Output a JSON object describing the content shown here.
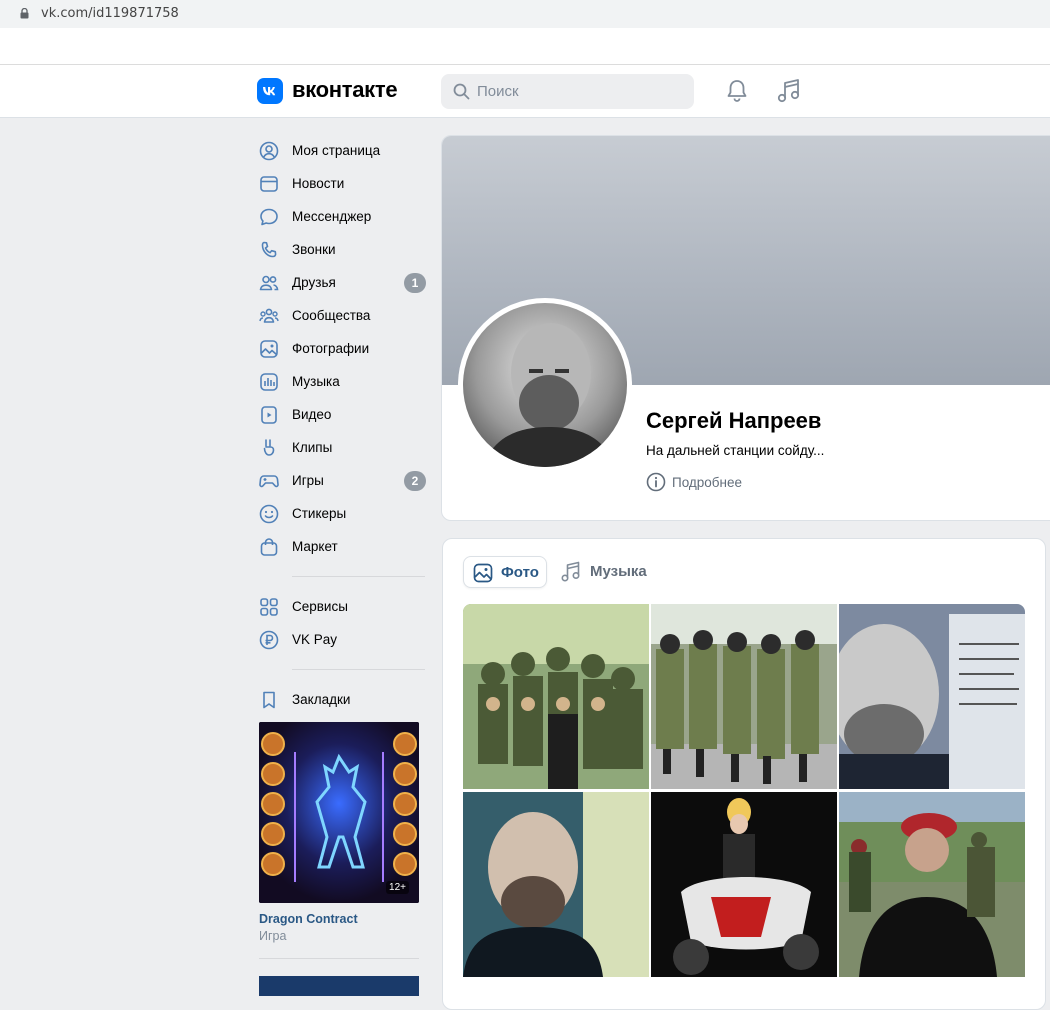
{
  "browser": {
    "url": "vk.com/id119871758"
  },
  "header": {
    "logo_text": "вконтакте",
    "search_placeholder": "Поиск",
    "notifications_icon": "bell-icon",
    "music_icon": "music-note-icon",
    "brand_color": "#0077ff"
  },
  "sidebar": {
    "items": [
      {
        "label": "Моя страница",
        "icon": "user-circle-icon"
      },
      {
        "label": "Новости",
        "icon": "news-icon"
      },
      {
        "label": "Мессенджер",
        "icon": "message-icon"
      },
      {
        "label": "Звонки",
        "icon": "phone-icon"
      },
      {
        "label": "Друзья",
        "icon": "friends-icon",
        "badge": "1"
      },
      {
        "label": "Сообщества",
        "icon": "communities-icon"
      },
      {
        "label": "Фотографии",
        "icon": "photo-icon"
      },
      {
        "label": "Музыка",
        "icon": "music-icon"
      },
      {
        "label": "Видео",
        "icon": "video-icon"
      },
      {
        "label": "Клипы",
        "icon": "clips-icon"
      },
      {
        "label": "Игры",
        "icon": "gamepad-icon",
        "badge": "2"
      },
      {
        "label": "Стикеры",
        "icon": "smile-icon"
      },
      {
        "label": "Маркет",
        "icon": "bag-icon"
      }
    ],
    "secondary": [
      {
        "label": "Сервисы",
        "icon": "services-icon"
      },
      {
        "label": "VK Pay",
        "icon": "ruble-icon"
      }
    ],
    "tertiary": [
      {
        "label": "Закладки",
        "icon": "bookmark-icon"
      }
    ],
    "game": {
      "title": "Dragon Contract",
      "subtitle": "Игра",
      "age": "12+"
    }
  },
  "profile": {
    "name": "Сергей Напреев",
    "status": "На дальней станции сойду...",
    "more_label": "Подробнее"
  },
  "media": {
    "tabs": [
      {
        "label": "Фото",
        "icon": "image-icon",
        "active": true
      },
      {
        "label": "Музыка",
        "icon": "music-note-icon",
        "active": false
      }
    ]
  }
}
